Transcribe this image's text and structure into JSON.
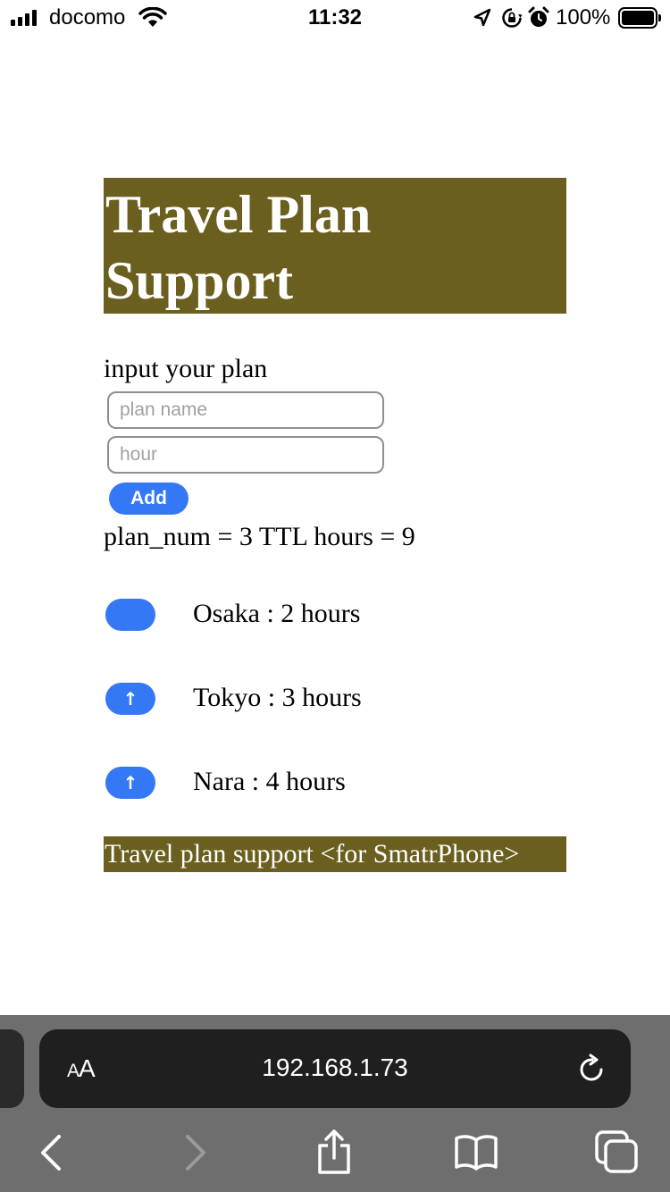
{
  "status_bar": {
    "carrier": "docomo",
    "time": "11:32",
    "battery_percent": "100%",
    "icons": [
      "signal-icon",
      "wifi-icon",
      "location-icon",
      "rotation-lock-icon",
      "alarm-icon",
      "battery-icon"
    ]
  },
  "page": {
    "title_line1": "Travel Plan",
    "title_line2": "Support",
    "input_label": "input your plan",
    "plan_name_placeholder": "plan name",
    "hour_placeholder": "hour",
    "add_label": "Add",
    "summary": "plan_num = 3 TTL hours = 9",
    "plans": [
      {
        "text": "Osaka : 2 hours",
        "button_icon": ""
      },
      {
        "text": "Tokyo : 3 hours",
        "button_icon": "↑"
      },
      {
        "text": "Nara : 4 hours",
        "button_icon": "↑"
      }
    ],
    "footer": "Travel plan support <for SmatrPhone>",
    "accent_color": "#6b5f1f",
    "button_color": "#3478f6"
  },
  "browser": {
    "aa_label_small": "A",
    "aa_label_big": "A",
    "url": "192.168.1.73",
    "icons": [
      "reload-icon",
      "back-icon",
      "forward-icon",
      "share-icon",
      "bookmarks-icon",
      "tabs-icon"
    ]
  }
}
